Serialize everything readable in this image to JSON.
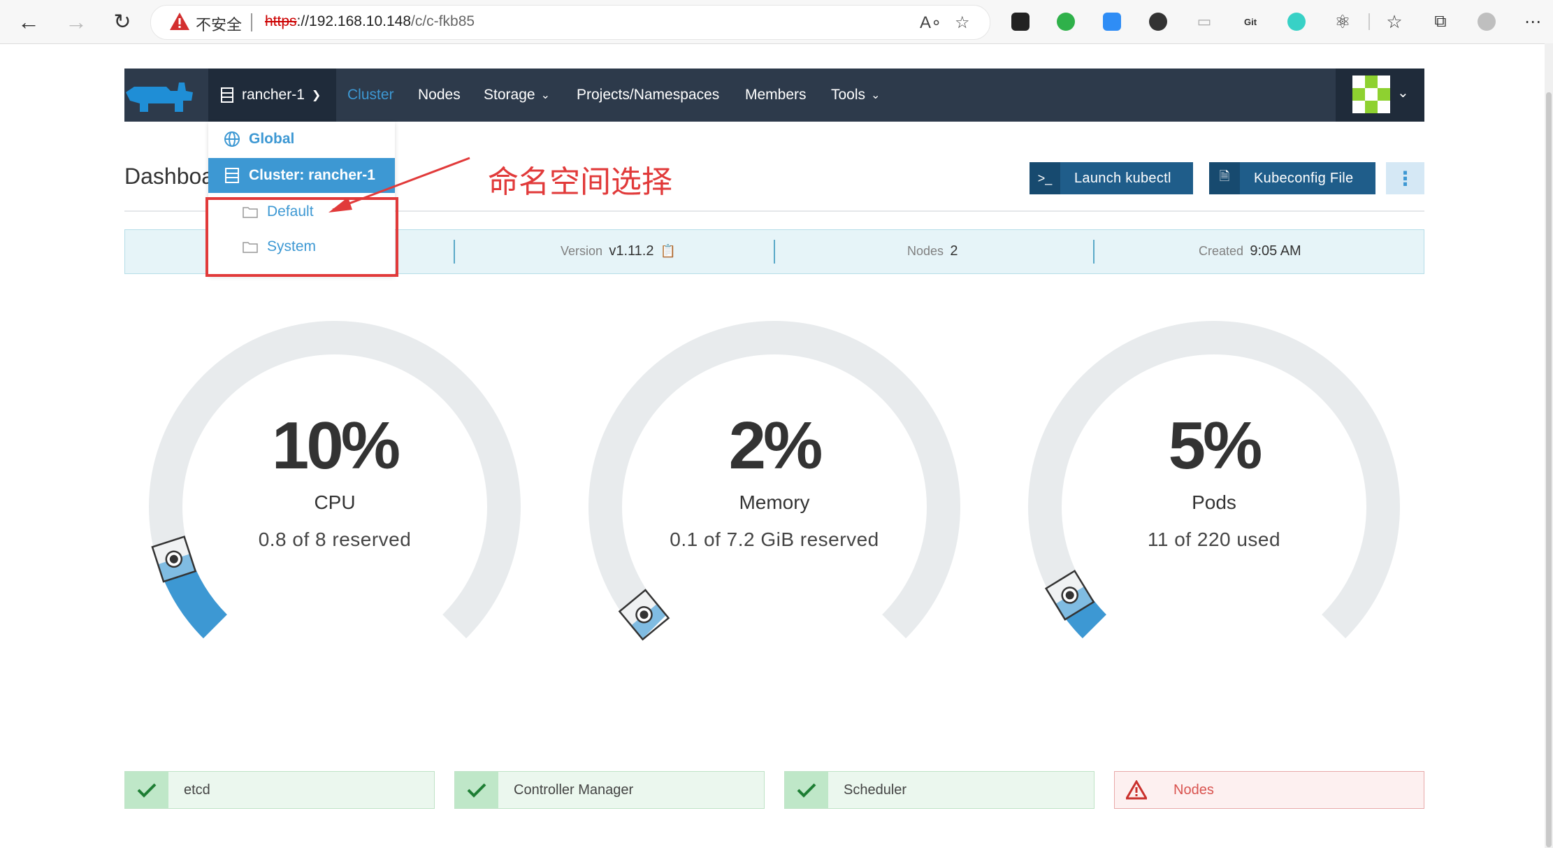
{
  "browser": {
    "insecure_label": "不安全",
    "url_scheme": "https",
    "url_host": "://192.168.10.148",
    "url_path": "/c/c-fkb85",
    "read_aloud_icon": "read-aloud-icon",
    "favorite_icon": "add-favorite-icon"
  },
  "header": {
    "cluster_name": "rancher-1",
    "nav": [
      "Cluster",
      "Nodes",
      "Storage",
      "Projects/Namespaces",
      "Members",
      "Tools"
    ]
  },
  "dropdown": {
    "global": "Global",
    "cluster": "Cluster: rancher-1",
    "namespaces": [
      "Default",
      "System"
    ]
  },
  "annotation": {
    "text": "命名空间选择",
    "color": "#e13a3a"
  },
  "page": {
    "title": "Dashboard",
    "launch_kubectl": "Launch kubectl",
    "kubeconfig": "Kubeconfig File"
  },
  "info": {
    "version_label": "Version",
    "version_value": "v1.11.2",
    "nodes_label": "Nodes",
    "nodes_value": "2",
    "created_label": "Created",
    "created_value": "9:05 AM"
  },
  "gauges": [
    {
      "percent_text": "10%",
      "label": "CPU",
      "detail": "0.8 of 8 reserved",
      "value": 0.1
    },
    {
      "percent_text": "2%",
      "label": "Memory",
      "detail": "0.1 of 7.2 GiB reserved",
      "value": 0.02
    },
    {
      "percent_text": "5%",
      "label": "Pods",
      "detail": "11 of 220 used",
      "value": 0.05
    }
  ],
  "status": [
    {
      "label": "etcd",
      "state": "ok"
    },
    {
      "label": "Controller Manager",
      "state": "ok"
    },
    {
      "label": "Scheduler",
      "state": "ok"
    },
    {
      "label": "Nodes",
      "state": "error"
    }
  ],
  "colors": {
    "accent": "#3d98d3",
    "header_bg": "#2d3a4b",
    "gauge_track": "#e8ebed",
    "ok": "#1e9e3e",
    "error": "#d9534f"
  }
}
